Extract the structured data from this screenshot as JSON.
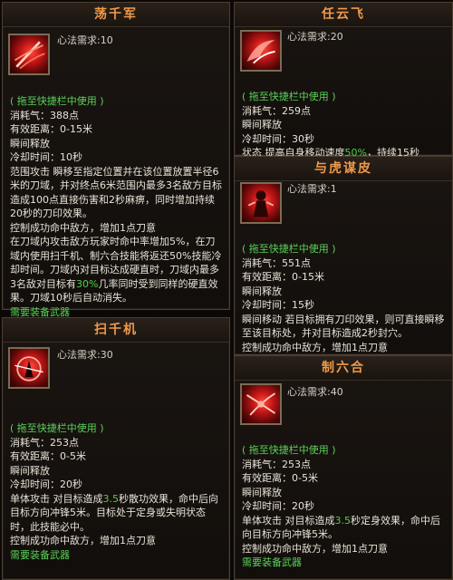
{
  "req_label": "心法需求:",
  "hotkey": "( 拖至快捷栏中使用 )",
  "need_weapon": "需要装备武器",
  "skills": {
    "s1": {
      "name": "荡千军",
      "icon": "sword-slash-icon",
      "req": "10",
      "cost": "消耗气：388点",
      "range": "有效距离：0-15米",
      "cast": "瞬间释放",
      "cd": "冷却时间：10秒",
      "d1": "范围攻击 瞬移至指定位置并在该位置放置半径6米的刀域，并对终点6米范围内最多3名敌方目标造成100点直接伤害和2秒麻痹，同时增加持续20秒的刀印效果。",
      "d2": "控制成功命中敌方，增加1点刀意",
      "d3": "在刀域内攻击敌方玩家时命中率增加5%，在刀域内使用扫千机、制六合技能将返还50%技能冷却时间。刀域内对目标达成硬直时，刀域内最多3名敌对目标有",
      "d3_hl": "30%",
      "d3b": "几率同时受到同样的硬直效果。刀域10秒后自动消失。"
    },
    "s2": {
      "name": "任云飞",
      "icon": "winged-slash-icon",
      "req": "20",
      "cost": "消耗气：259点",
      "cast": "瞬间释放",
      "cd": "冷却时间：30秒",
      "d1a": "状态 提高自身移动速度",
      "d1_hl": "50%",
      "d1b": "，持续15秒"
    },
    "s3": {
      "name": "与虎谋皮",
      "icon": "tiger-figure-icon",
      "req": "1",
      "cost": "消耗气：551点",
      "range": "有效距离：0-15米",
      "cast": "瞬间释放",
      "cd": "冷却时间：15秒",
      "d1": "瞬间移动 若目标拥有刀印效果，则可直接瞬移至该目标处，并对目标造成2秒封穴。",
      "d2": "控制成功命中敌方，增加1点刀意"
    },
    "s4": {
      "name": "扫千机",
      "icon": "whirl-strike-icon",
      "req": "30",
      "cost": "消耗气：253点",
      "range": "有效距离：0-5米",
      "cast": "瞬间释放",
      "cd": "冷却时间：20秒",
      "d1a": "单体攻击 对目标造成",
      "d1_hl": "3.5",
      "d1b": "秒散功效果，命中后向目标方向冲锋5米。目标处于定身或失明状态时，此技能必中。",
      "d2": "控制成功命中敌方，增加1点刀意"
    },
    "s5": {
      "name": "制六合",
      "icon": "chain-bind-icon",
      "req": "40",
      "cost": "消耗气：253点",
      "range": "有效距离：0-5米",
      "cast": "瞬间释放",
      "cd": "冷却时间：20秒",
      "d1a": "单体攻击 对目标造成",
      "d1_hl": "3.5",
      "d1b": "秒定身效果，命中后向目标方向冲锋5米。",
      "d2": "控制成功命中敌方，增加1点刀意"
    }
  }
}
